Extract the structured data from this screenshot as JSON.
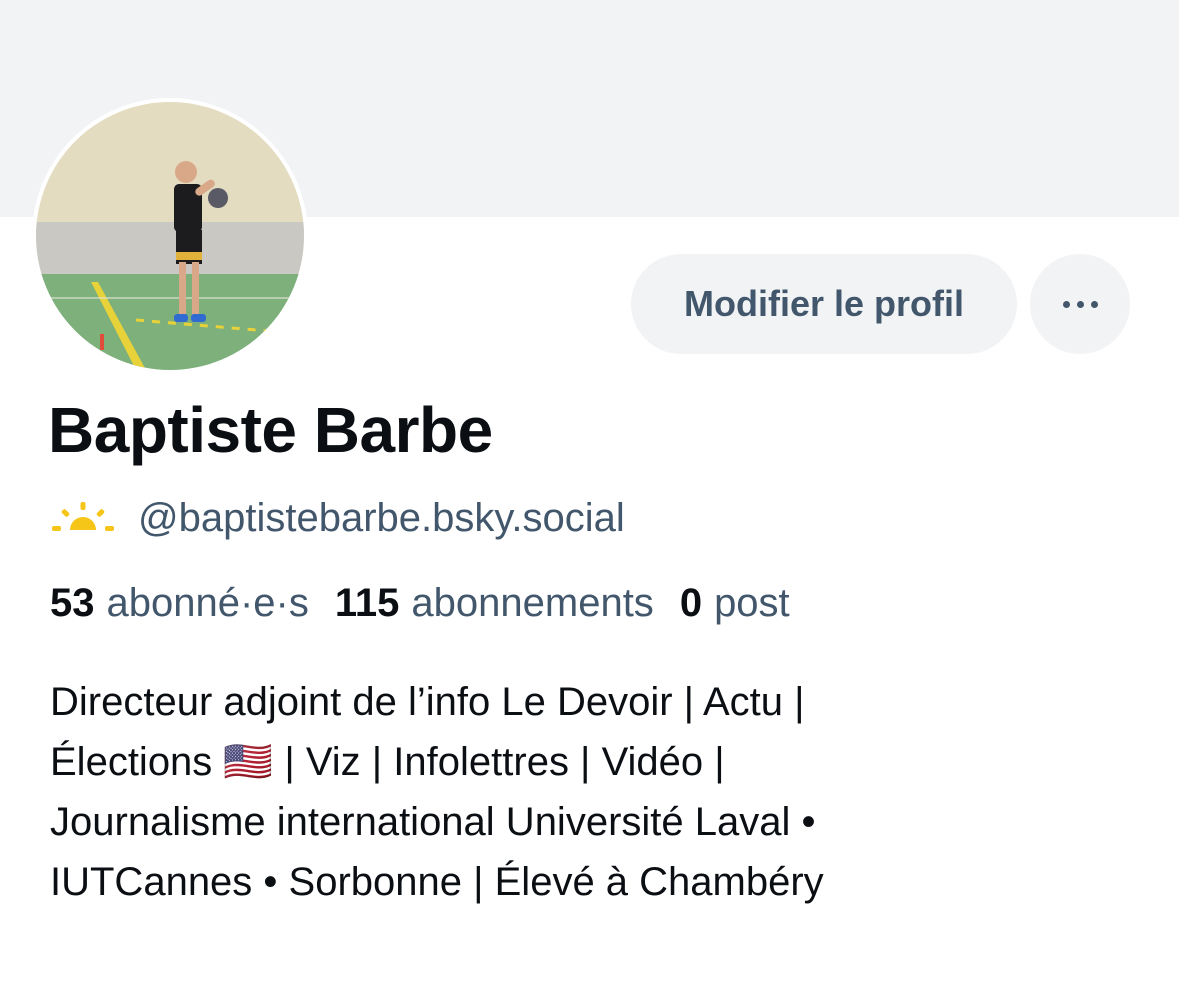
{
  "profile": {
    "name": "Baptiste Barbe",
    "handle": "@baptistebarbe.bsky.social",
    "handle_icon": "sun-horizon-icon",
    "avatar_alt": "avatar",
    "stats": [
      {
        "count": "53",
        "label": "abonné·e·s"
      },
      {
        "count": "115",
        "label": "abonnements"
      },
      {
        "count": "0",
        "label": "post"
      }
    ],
    "bio": "Directeur adjoint de l’info Le Devoir | Actu |\nÉlections 🇺🇸 | Viz | Infolettres | Vidéo |\nJournalisme international Université Laval •\nIUTCannes • Sorbonne | Élevé à Chambéry"
  },
  "actions": {
    "edit_label": "Modifier le profil",
    "more_icon": "ellipsis-icon"
  },
  "colors": {
    "banner": "#f1f3f5",
    "button_bg": "#f1f3f5",
    "secondary_text": "#42576c",
    "primary_text": "#0b0f14",
    "sun": "#f5c518"
  }
}
